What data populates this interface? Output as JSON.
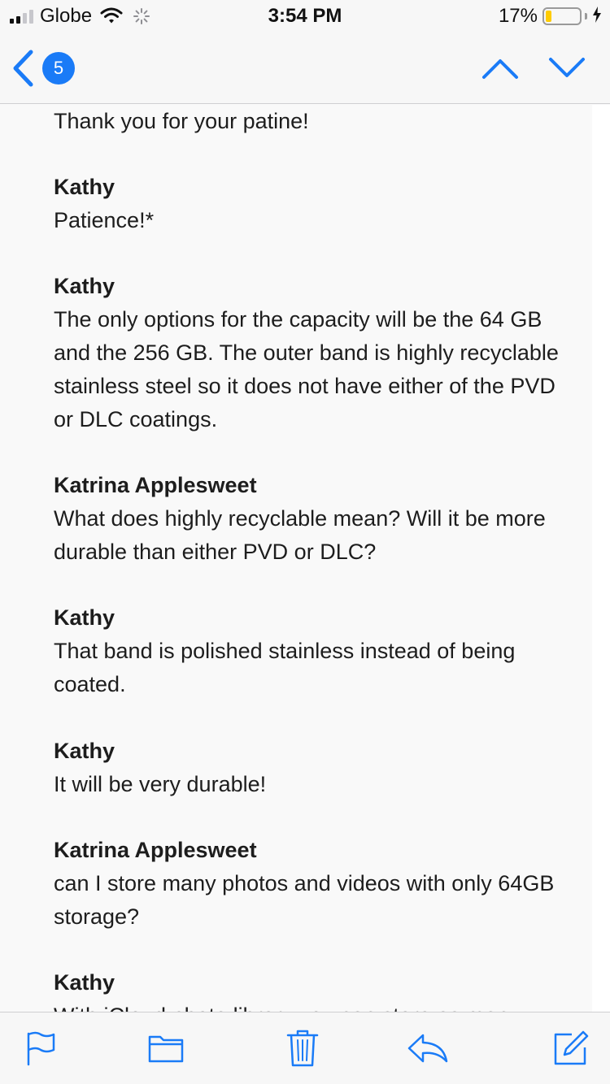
{
  "status_bar": {
    "carrier": "Globe",
    "time": "3:54 PM",
    "battery_percent": "17%",
    "battery_level": 0.17,
    "signal_bars": 4,
    "signal_bars_filled": 2,
    "icons": [
      "signal-icon",
      "wifi-icon",
      "loading-icon",
      "battery-icon",
      "charging-bolt-icon"
    ]
  },
  "nav": {
    "back_count": "5",
    "back_icon": "chevron-left-icon",
    "prev_icon": "chevron-up-icon",
    "next_icon": "chevron-down-icon",
    "accent_color": "#1a7bf7"
  },
  "messages": [
    {
      "text": "Thank you for your patine!"
    },
    {
      "sender": "Kathy",
      "text": "Patience!*"
    },
    {
      "sender": "Kathy",
      "text": "The only options for the capacity will be the 64 GB and the 256 GB. The outer band is highly recyclable stainless steel so it does not have either of the PVD or DLC coatings."
    },
    {
      "sender": "Katrina Applesweet",
      "text": "What does highly recyclable mean? Will it be more durable than either PVD or DLC?"
    },
    {
      "sender": "Kathy",
      "text": "That band is polished stainless instead of being coated."
    },
    {
      "sender": "Kathy",
      "text": "It will be very durable!"
    },
    {
      "sender": "Katrina Applesweet",
      "text": "can I store many photos and videos with only 64GB storage?"
    },
    {
      "sender": "Kathy",
      "text": "With iCloud photo library you can store as many"
    }
  ],
  "toolbar": {
    "icons": [
      "flag-icon",
      "folder-icon",
      "trash-icon",
      "reply-icon",
      "compose-icon"
    ]
  }
}
